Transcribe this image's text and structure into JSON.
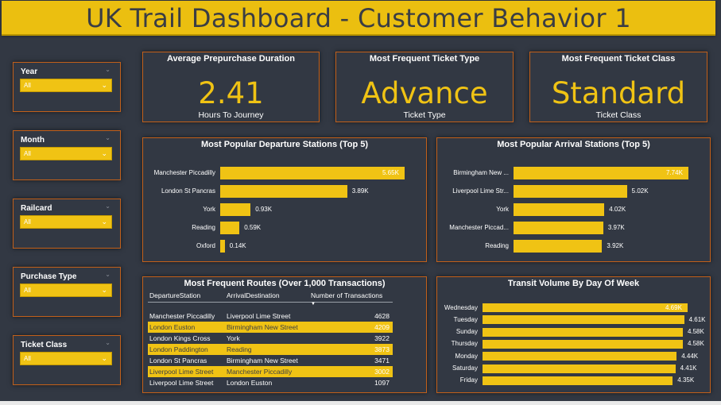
{
  "title": "UK Trail Dashboard - Customer Behavior 1",
  "colors": {
    "background": "#323843",
    "accent": "#f0c314",
    "border": "#c2601a"
  },
  "slicers": [
    {
      "label": "Year",
      "value": "All"
    },
    {
      "label": "Month",
      "value": "All"
    },
    {
      "label": "Railcard",
      "value": "All"
    },
    {
      "label": "Purchase Type",
      "value": "All"
    },
    {
      "label": "Ticket Class",
      "value": "All"
    }
  ],
  "kpis": [
    {
      "title": "Average Prepurchase Duration",
      "value": "2.41",
      "caption": "Hours To Journey"
    },
    {
      "title": "Most Frequent Ticket Type",
      "value": "Advance",
      "caption": "Ticket Type"
    },
    {
      "title": "Most Frequent Ticket Class",
      "value": "Standard",
      "caption": "Ticket Class"
    }
  ],
  "departure": {
    "title": "Most Popular Departure Stations (Top 5)"
  },
  "arrival": {
    "title": "Most Popular Arrival Stations (Top 5)"
  },
  "routes": {
    "title": "Most Frequent Routes (Over 1,000 Transactions)",
    "headers": [
      "DepartureStation",
      "ArrivalDestination",
      "Number of Transactions"
    ],
    "rows": [
      [
        "Manchester Piccadilly",
        "Liverpool Lime Street",
        "4628"
      ],
      [
        "London Euston",
        "Birmingham New Street",
        "4209"
      ],
      [
        "London Kings Cross",
        "York",
        "3922"
      ],
      [
        "London Paddington",
        "Reading",
        "3873"
      ],
      [
        "London St Pancras",
        "Birmingham New Street",
        "3471"
      ],
      [
        "Liverpool Lime Street",
        "Manchester Piccadilly",
        "3002"
      ],
      [
        "Liverpool Lime Street",
        "London Euston",
        "1097"
      ]
    ]
  },
  "transit": {
    "title": "Transit Volume By Day Of Week"
  },
  "chart_data": [
    {
      "type": "bar",
      "orientation": "horizontal",
      "title": "Most Popular Departure Stations (Top 5)",
      "categories": [
        "Manchester Piccadilly",
        "London St Pancras",
        "York",
        "Reading",
        "Oxford"
      ],
      "values": [
        5650,
        3890,
        930,
        590,
        140
      ],
      "value_labels": [
        "5.65K",
        "3.89K",
        "0.93K",
        "0.59K",
        "0.14K"
      ],
      "xlim": [
        0,
        5650
      ]
    },
    {
      "type": "bar",
      "orientation": "horizontal",
      "title": "Most Popular Arrival Stations (Top 5)",
      "categories": [
        "Birmingham New ...",
        "Liverpool Lime Str...",
        "York",
        "Manchester Piccad...",
        "Reading"
      ],
      "values": [
        7740,
        5020,
        4020,
        3970,
        3920
      ],
      "value_labels": [
        "7.74K",
        "5.02K",
        "4.02K",
        "3.97K",
        "3.92K"
      ],
      "xlim": [
        0,
        7740
      ]
    },
    {
      "type": "bar",
      "orientation": "horizontal",
      "title": "Transit Volume By Day Of Week",
      "categories": [
        "Wednesday",
        "Tuesday",
        "Sunday",
        "Thursday",
        "Monday",
        "Saturday",
        "Friday"
      ],
      "values": [
        4690,
        4610,
        4580,
        4580,
        4440,
        4410,
        4350
      ],
      "value_labels": [
        "4.69K",
        "4.61K",
        "4.58K",
        "4.58K",
        "4.44K",
        "4.41K",
        "4.35K"
      ],
      "xlim": [
        0,
        4690
      ]
    }
  ]
}
